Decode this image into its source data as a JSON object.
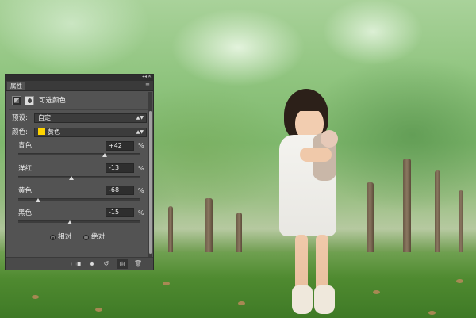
{
  "panel": {
    "tab_label": "属性",
    "title": "可选颜色",
    "preset_label": "预设:",
    "preset_value": "自定",
    "color_label": "颜色:",
    "color_value": "黄色",
    "color_swatch": "#ffd400",
    "sliders": [
      {
        "label": "青色:",
        "value": "+42",
        "unit": "%",
        "level": 0.71
      },
      {
        "label": "洋红:",
        "value": "-13",
        "unit": "%",
        "level": 0.435
      },
      {
        "label": "黄色:",
        "value": "-68",
        "unit": "%",
        "level": 0.16
      },
      {
        "label": "黑色:",
        "value": "-15",
        "unit": "%",
        "level": 0.425
      }
    ],
    "radio_relative": "相对",
    "radio_absolute": "绝对",
    "radio_selected": "relative"
  },
  "icons": {
    "bottom_toolbar": [
      "clip-to-layer-icon",
      "view-previous-state-icon",
      "reset-icon",
      "visibility-icon",
      "delete-icon"
    ]
  }
}
